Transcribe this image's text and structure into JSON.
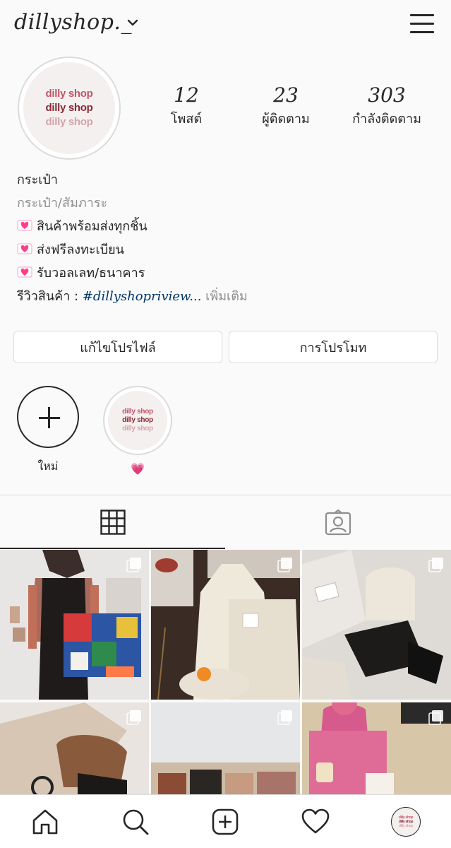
{
  "header": {
    "username": "dillyshop._",
    "icons": [
      "chevron-down-icon",
      "menu-icon"
    ]
  },
  "profile": {
    "logo_lines": [
      "dilly shop",
      "dilly shop",
      "dilly shop"
    ],
    "logo_colors": [
      "#c2566a",
      "#8a2a35",
      "#d4a4ab"
    ],
    "stats": [
      {
        "value": "12",
        "label": "โพสต์"
      },
      {
        "value": "23",
        "label": "ผู้ติดตาม"
      },
      {
        "value": "303",
        "label": "กำลังติดตาม"
      }
    ]
  },
  "bio": {
    "name": "กระเป๋า",
    "category": "กระเป๋า/สัมภาระ",
    "lines": [
      "สินค้าพร้อมส่งทุกชิ้น",
      "ส่งฟรีลงทะเบียน",
      "รับวอลเลท/ธนาคาร"
    ],
    "review_label": "รีวิวสินค้า : ",
    "review_tag": "#dillyshopriview...",
    "more_label": " เพิ่มเติม"
  },
  "buttons": {
    "edit_profile": "แก้ไขโปรไฟล์",
    "promotions": "การโปรโมท"
  },
  "highlights": {
    "new_label": "ใหม่",
    "story_label": "💗"
  },
  "tabs": [
    "grid-icon",
    "tagged-icon"
  ],
  "nav": [
    "home-icon",
    "search-icon",
    "add-post-icon",
    "heart-icon",
    "profile-avatar"
  ],
  "colors": {
    "link": "#00376b",
    "muted": "#8e8e8e",
    "border": "#dbdbdb",
    "text": "#262626",
    "heart": "#ff3d8b"
  }
}
